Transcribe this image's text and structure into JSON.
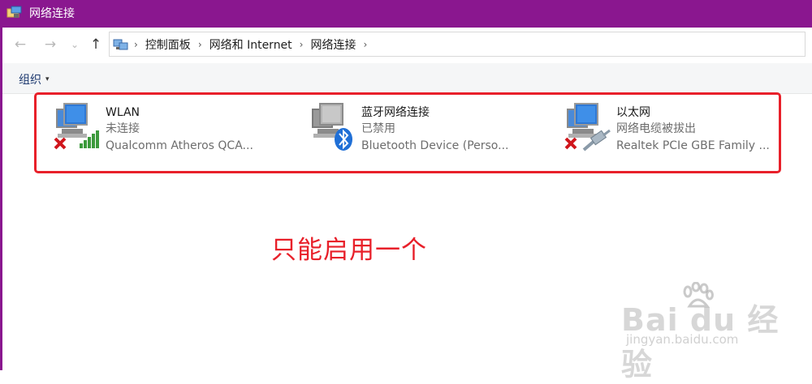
{
  "window": {
    "title": "网络连接"
  },
  "navigation": {
    "back_label": "←",
    "forward_label": "→",
    "dropdown_label": "⌄",
    "up_label": "↑",
    "breadcrumbs": [
      {
        "label": "控制面板"
      },
      {
        "label": "网络和 Internet"
      },
      {
        "label": "网络连接"
      }
    ],
    "separator": "›"
  },
  "toolbar": {
    "organize_label": "组织",
    "organize_caret": "▾"
  },
  "connections": [
    {
      "name": "WLAN",
      "status": "未连接",
      "device": "Qualcomm Atheros QCA...",
      "icon": "wifi-adapter-icon",
      "state": "disconnected"
    },
    {
      "name": "蓝牙网络连接",
      "status": "已禁用",
      "device": "Bluetooth Device (Perso...",
      "icon": "bluetooth-adapter-icon",
      "state": "disabled"
    },
    {
      "name": "以太网",
      "status": "网络电缆被拔出",
      "device": "Realtek PCIe GBE Family ...",
      "icon": "ethernet-adapter-icon",
      "state": "disconnected"
    }
  ],
  "annotation": {
    "text": "只能启用一个",
    "color": "#e8202a"
  },
  "watermark": {
    "main": "Bai du 经验",
    "sub": "jingyan.baidu.com"
  },
  "colors": {
    "titlebar": "#8a178f",
    "highlight_border": "#e8202a"
  }
}
